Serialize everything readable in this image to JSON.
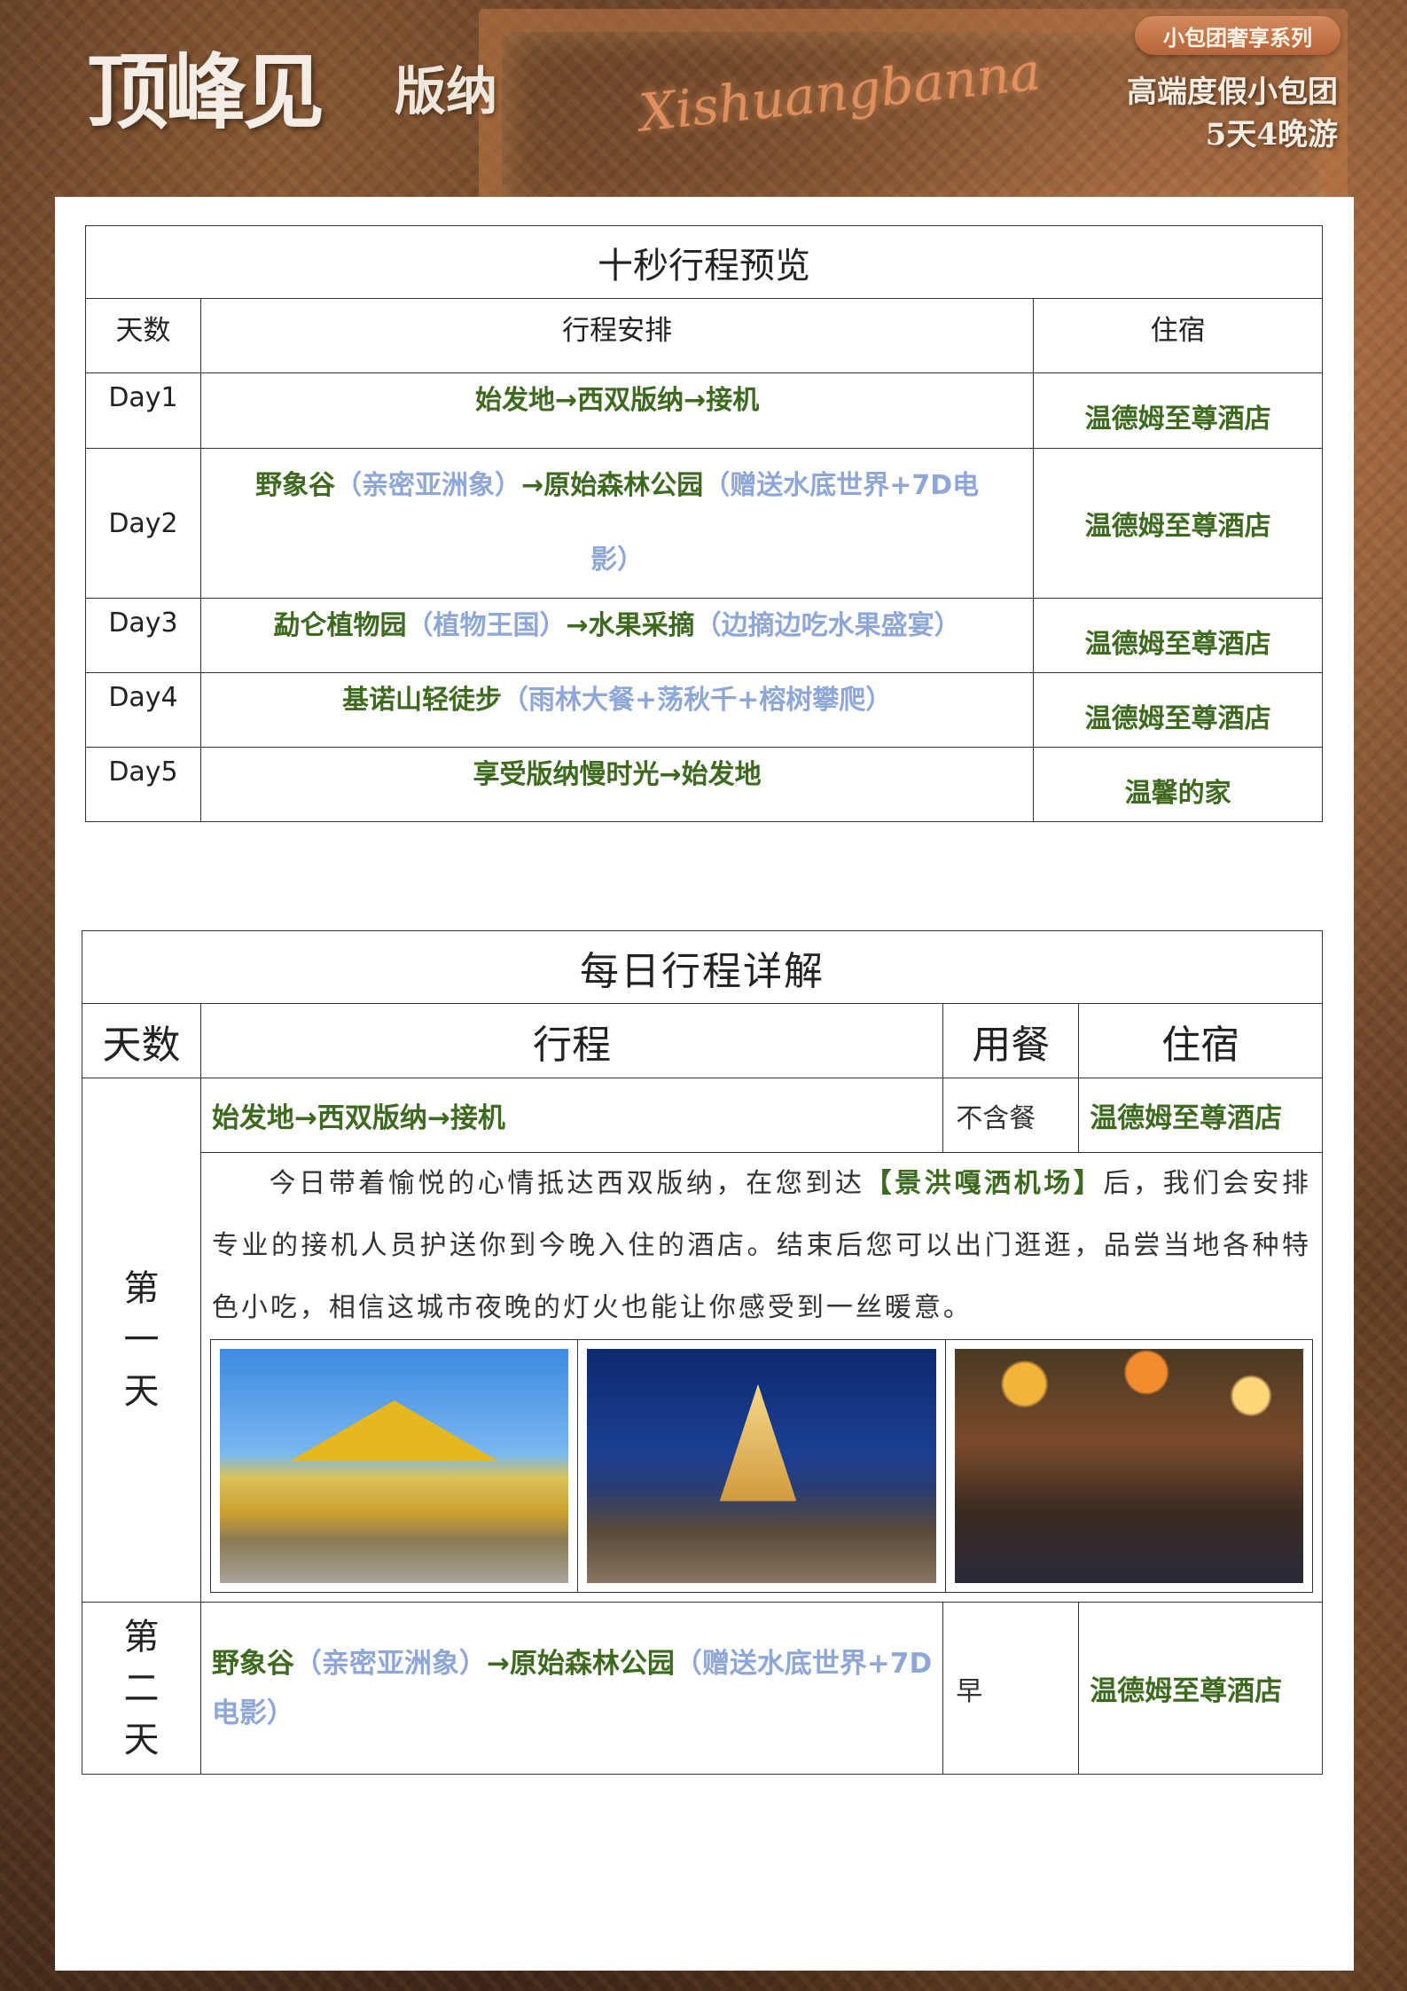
{
  "banner": {
    "title": "顶峰见",
    "subtitle": "版纳",
    "script_logo": "Xishuangbanna",
    "series_badge": "小包团奢享系列",
    "right_line1": "高端度假小包团",
    "right_line2": "5天4晚游"
  },
  "overview": {
    "title": "十秒行程预览",
    "headers": {
      "day": "天数",
      "plan": "行程安排",
      "hotel": "住宿"
    },
    "rows": [
      {
        "day": "Day1",
        "plan_main": "始发地→西双版纳→接机",
        "plan_extra": "",
        "hotel": "温德姆至尊酒店"
      },
      {
        "day": "Day2",
        "plan_main": "野象谷",
        "plan_extra": "（亲密亚洲象）",
        "plan_main2": "→原始森林公园",
        "plan_extra2": "（赠送水底世界+7D电影）",
        "hotel": "温德姆至尊酒店"
      },
      {
        "day": "Day3",
        "plan_main": "勐仑植物园",
        "plan_extra": "（植物王国）",
        "plan_main2": "→水果采摘",
        "plan_extra2": "（边摘边吃水果盛宴）",
        "hotel": "温德姆至尊酒店"
      },
      {
        "day": "Day4",
        "plan_main": "基诺山轻徒步",
        "plan_extra": "（雨林大餐+荡秋千+榕树攀爬）",
        "hotel": "温德姆至尊酒店"
      },
      {
        "day": "Day5",
        "plan_main": "享受版纳慢时光→始发地",
        "plan_extra": "",
        "hotel": "温馨的家"
      }
    ]
  },
  "detail": {
    "title": "每日行程详解",
    "headers": {
      "day": "天数",
      "route": "行程",
      "meal": "用餐",
      "hotel": "住宿"
    },
    "day1": {
      "label": "第一天",
      "route": "始发地→西双版纳→接机",
      "meal": "不含餐",
      "hotel": "温德姆至尊酒店",
      "desc_before": "今日带着愉悦的心情抵达西双版纳，在您到达",
      "desc_highlight": "【景洪嘎洒机场】",
      "desc_after": "后，我们会安排专业的接机人员护送你到今晚入住的酒店。结束后您可以出门逛逛，品尝当地各种特  色小吃，相信这城市夜晚的灯火也能让你感受到一丝暖意。"
    },
    "day2": {
      "label": "第二天",
      "route_main": "野象谷",
      "route_extra": "（亲密亚洲象）",
      "route_main2": "→原始森林公园",
      "route_extra2": "（赠送水底世界+7D电影）",
      "meal": "早",
      "hotel": "温德姆至尊酒店"
    }
  }
}
